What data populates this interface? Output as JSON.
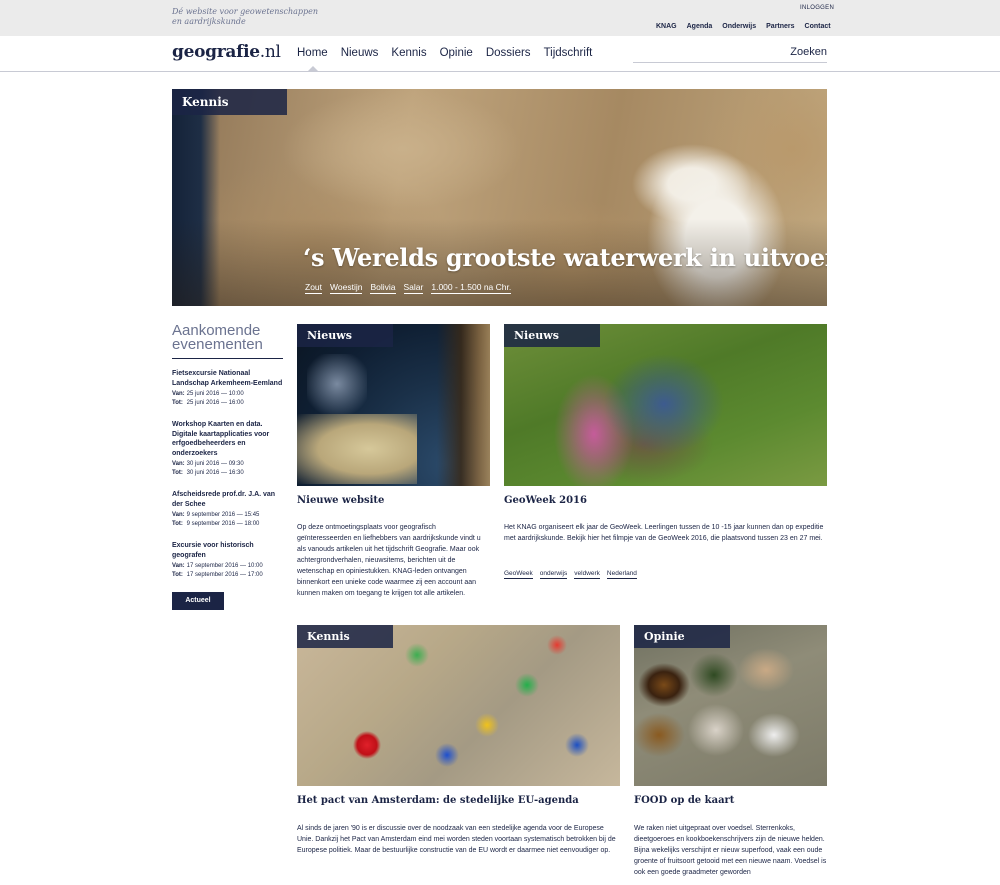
{
  "header": {
    "tagline_line1": "Dé website voor geowetenschappen",
    "tagline_line2": "en aardrijkskunde",
    "login": "INLOGGEN",
    "top_links": [
      "KNAG",
      "Agenda",
      "Onderwijs",
      "Partners",
      "Contact"
    ]
  },
  "logo": {
    "name": "geografie",
    "tld": ".nl"
  },
  "nav": {
    "items": [
      "Home",
      "Nieuws",
      "Kennis",
      "Opinie",
      "Dossiers",
      "Tijdschrift"
    ],
    "active": "Home"
  },
  "search": {
    "placeholder": "Zoeken"
  },
  "hero": {
    "label": "Kennis",
    "title": "‘s Werelds grootste waterwerk in uitvoering",
    "tags": [
      "Zout",
      "Woestijn",
      "Bolivia",
      "Salar",
      "1.000 - 1.500 na Chr."
    ]
  },
  "events": {
    "title_line1": "Aankomende",
    "title_line2": "evenementen",
    "from_label": "Van:",
    "to_label": "Tot:",
    "items": [
      {
        "title": "Fietsexcursie Nationaal Landschap Arkemheem-Eemland",
        "from": "25 juni 2016 — 10:00",
        "to": "25 juni 2016 — 16:00"
      },
      {
        "title": "Workshop Kaarten en data. Digitale kaartapplicaties voor erfgoedbeheerders en onderzoekers",
        "from": "30 juni 2016 — 09:30",
        "to": "30 juni 2016 — 16:30"
      },
      {
        "title": "Afscheidsrede prof.dr. J.A. van der Schee",
        "from": "9 september 2016 — 15:45",
        "to": "9 september 2016 — 18:00"
      },
      {
        "title": "Excursie voor historisch geografen",
        "from": "17 september 2016 — 10:00",
        "to": "17 september 2016 — 17:00"
      }
    ],
    "button": "Actueel"
  },
  "cards": [
    {
      "label": "Nieuws",
      "title": "Nieuwe website",
      "text": "Op deze ontmoetingsplaats voor geografisch geïnteresseerden en liefhebbers van aardrijkskunde vindt u als vanouds artikelen uit het tijdschrift Geografie. Maar ook achtergrondverhalen, nieuwsitems, berichten uit de wetenschap en opiniestukken. KNAG-leden ontvangen binnenkort een unieke code waarmee zij een account aan kunnen maken om toegang te krijgen tot alle artikelen.",
      "tags": []
    },
    {
      "label": "Nieuws",
      "title": "GeoWeek 2016",
      "text": "Het KNAG organiseert elk jaar de GeoWeek. Leerlingen tussen de 10 -15 jaar kunnen dan op expeditie met aardrijkskunde. Bekijk hier het filmpje van de GeoWeek 2016, die plaatsvond tussen 23 en 27 mei.",
      "tags": [
        "GeoWeek",
        "onderwijs",
        "veldwerk",
        "Nederland"
      ]
    },
    {
      "label": "Kennis",
      "title": "Het pact van Amsterdam: de stedelijke EU-agenda",
      "text": "Al sinds de jaren '90 is er discussie over de noodzaak van een stedelijke agenda voor de Europese Unie. Dankzij het Pact van Amsterdam eind mei worden steden voortaan systematisch betrokken bij de Europese politiek. Maar de bestuurlijke constructie van de EU wordt er daarmee niet eenvoudiger op.",
      "tags": []
    },
    {
      "label": "Opinie",
      "title": "FOOD op de kaart",
      "text": "We raken niet uitgepraat over voedsel. Sterrenkoks, dieetgoeroes en kookboekenschrijvers zijn de nieuwe helden. Bijna wekelijks verschijnt er nieuw superfood, vaak een oude groente of fruitsoort getooid met een nieuwe naam. Voedsel is ook een goede graadmeter geworden",
      "tags": []
    }
  ],
  "colors": {
    "brand_navy": "#1b2445",
    "topbar_gray": "#ebebeb",
    "muted_text": "#6b7390"
  }
}
